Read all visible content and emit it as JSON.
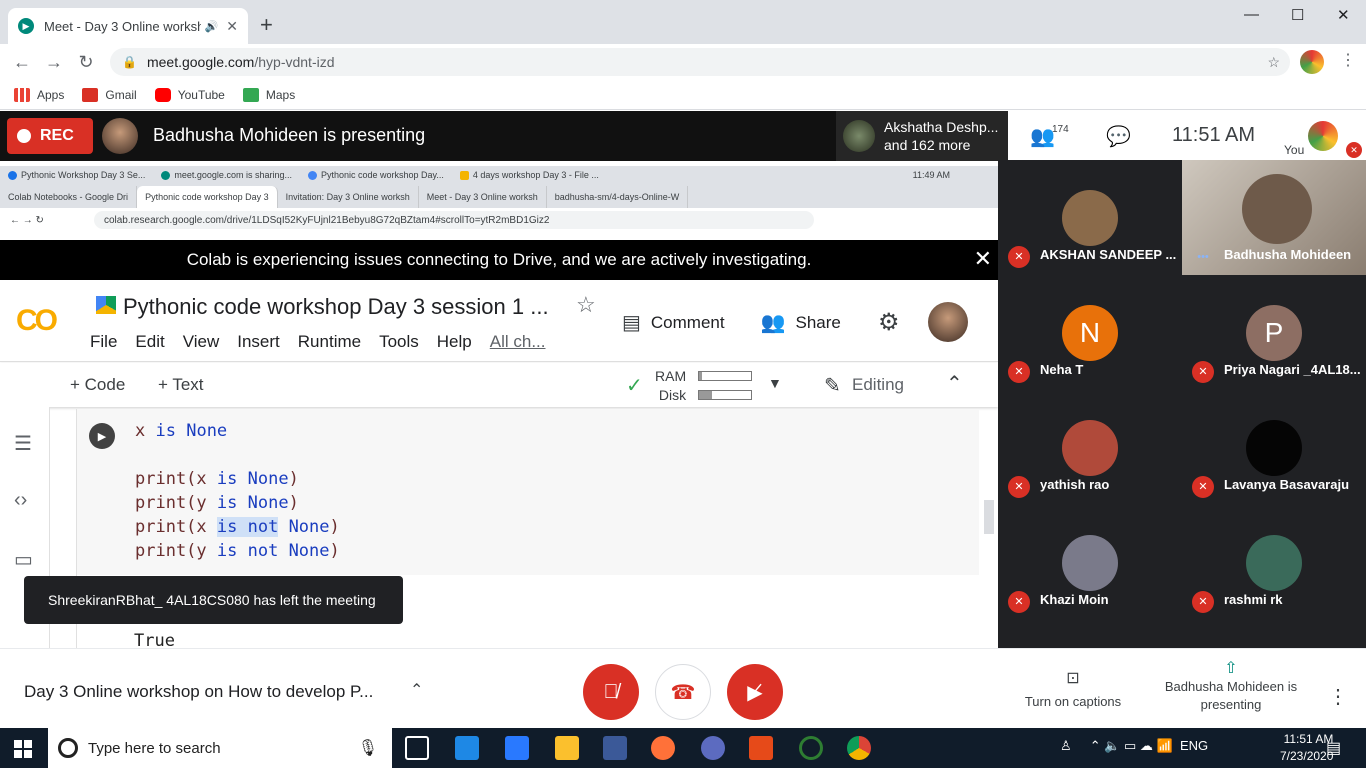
{
  "browser": {
    "tab_title": "Meet - Day 3 Online worksho",
    "url_host": "meet.google.com",
    "url_path": "/hyp-vdnt-izd",
    "bookmarks": [
      {
        "label": "Apps",
        "icon": "apps-grid-icon",
        "color": "#ea4335"
      },
      {
        "label": "Gmail",
        "icon": "gmail-icon",
        "color": "#d93025"
      },
      {
        "label": "YouTube",
        "icon": "youtube-icon",
        "color": "#ff0000"
      },
      {
        "label": "Maps",
        "icon": "maps-icon",
        "color": "#34a853"
      }
    ]
  },
  "meet": {
    "rec_label": "REC",
    "presenting_text": "Badhusha Mohideen is presenting",
    "pinned_name": "Akshatha Deshp...",
    "pinned_more": "and 162 more",
    "people_count": "174",
    "clock": "11:51  AM",
    "you_label": "You",
    "meeting_title": "Day 3 Online workshop on How to develop P...",
    "captions_label": "Turn on captions",
    "presenter_label": "Badhusha Mohideen is presenting",
    "toast": "ShreekiranRBhat_ 4AL18CS080 has left the meeting"
  },
  "participants": [
    {
      "name": "AKSHAN SANDEEP ...",
      "initial": "",
      "color": "#8a6a4a"
    },
    {
      "name": "Badhusha Mohideen",
      "initial": "",
      "color": "#6e5a4a"
    },
    {
      "name": "Neha T",
      "initial": "N",
      "color": "#e8710a"
    },
    {
      "name": "Priya Nagari _4AL18...",
      "initial": "P",
      "color": "#8d6e63"
    },
    {
      "name": "yathish rao",
      "initial": "",
      "color": "#b04a3a"
    },
    {
      "name": "Lavanya Basavaraju",
      "initial": "",
      "color": "#050505"
    },
    {
      "name": "Khazi Moin",
      "initial": "",
      "color": "#7a7a8a"
    },
    {
      "name": "rashmi rk",
      "initial": "",
      "color": "#3a6a5a"
    }
  ],
  "shared": {
    "os_tabs": [
      "Pythonic Workshop Day 3 Se...",
      "meet.google.com is sharing...",
      "Pythonic code workshop Day...",
      "4 days workshop Day 3 - File ..."
    ],
    "os_clock": "11:49 AM",
    "browser_tabs": [
      "Colab Notebooks - Google Dri",
      "Pythonic code workshop Day 3",
      "Invitation: Day 3 Online worksh",
      "Meet - Day 3 Online worksh",
      "badhusha-sm/4-days-Online-W"
    ],
    "url": "colab.research.google.com/drive/1LDSqI52KyFUjnl21Bebyu8G72qBZtam4#scrollTo=ytR2mBD1Giz2",
    "banner": "Colab is experiencing issues connecting to Drive, and we are actively investigating.",
    "logo_text": "CO",
    "notebook_title": "Pythonic code workshop Day 3 session 1 ...",
    "menus": [
      "File",
      "Edit",
      "View",
      "Insert",
      "Runtime",
      "Tools",
      "Help"
    ],
    "all_changes": "All ch...",
    "comment": "Comment",
    "share": "Share",
    "add_code": "+ Code",
    "add_text": "+ Text",
    "ram": "RAM",
    "disk": "Disk",
    "ram_fraction": 0.05,
    "disk_fraction": 0.25,
    "editing": "Editing",
    "code_lines": [
      [
        {
          "t": "x "
        },
        {
          "t": "is",
          "k": 1
        },
        {
          "t": " "
        },
        {
          "t": "None",
          "k": 1
        }
      ],
      [],
      [
        {
          "t": "print(x "
        },
        {
          "t": "is",
          "k": 1
        },
        {
          "t": " "
        },
        {
          "t": "None",
          "k": 1
        },
        {
          "t": ")"
        }
      ],
      [
        {
          "t": "print(y "
        },
        {
          "t": "is",
          "k": 1
        },
        {
          "t": " "
        },
        {
          "t": "None",
          "k": 1
        },
        {
          "t": ")"
        }
      ],
      [
        {
          "t": "print(x "
        },
        {
          "t": "is not",
          "k": 1,
          "s": 1
        },
        {
          "t": " "
        },
        {
          "t": "None",
          "k": 1
        },
        {
          "t": ")"
        }
      ],
      [
        {
          "t": "print(y "
        },
        {
          "t": "is not",
          "k": 1
        },
        {
          "t": " "
        },
        {
          "t": "None",
          "k": 1
        },
        {
          "t": ")"
        }
      ]
    ],
    "output_lines": [
      "True",
      "True"
    ]
  },
  "taskbar": {
    "search_placeholder": "Type here to search",
    "lang": "ENG",
    "time": "11:51 AM",
    "date": "7/23/2020"
  }
}
